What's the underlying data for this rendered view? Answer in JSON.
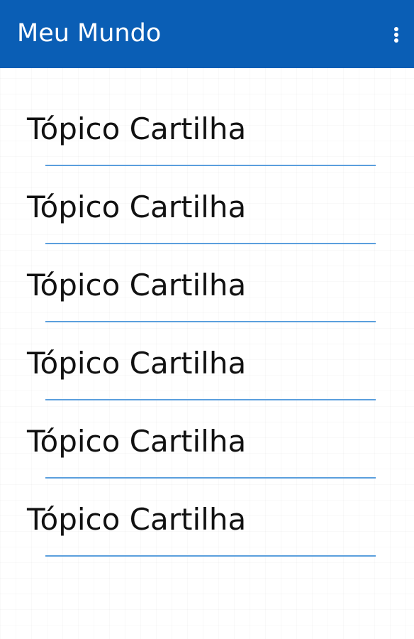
{
  "app_bar": {
    "title": "Meu Mundo",
    "menu_icon": "more-vert-icon",
    "color": "#0a5eb5"
  },
  "topics": [
    {
      "label": "Tópico Cartilha"
    },
    {
      "label": "Tópico Cartilha"
    },
    {
      "label": "Tópico Cartilha"
    },
    {
      "label": "Tópico Cartilha"
    },
    {
      "label": "Tópico Cartilha"
    },
    {
      "label": "Tópico Cartilha"
    }
  ],
  "colors": {
    "divider": "#5b9fdd",
    "text": "#111111"
  }
}
